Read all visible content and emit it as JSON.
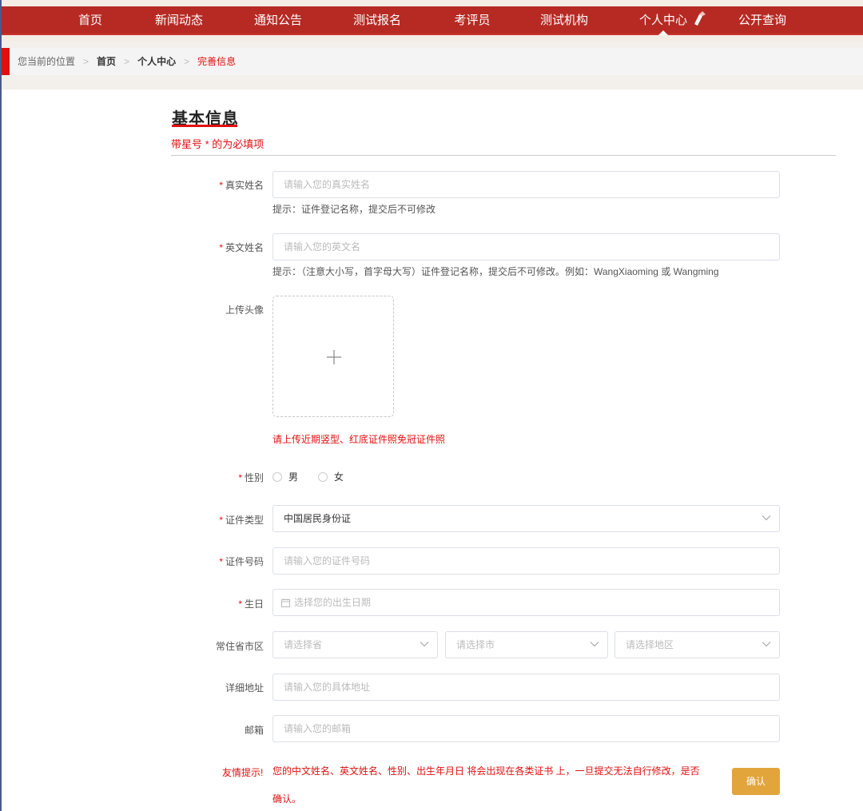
{
  "nav": {
    "items": [
      {
        "label": "首页"
      },
      {
        "label": "新闻动态"
      },
      {
        "label": "通知公告"
      },
      {
        "label": "测试报名"
      },
      {
        "label": "考评员"
      },
      {
        "label": "测试机构"
      },
      {
        "label": "个人中心"
      },
      {
        "label": "公开查询"
      }
    ],
    "active_index": 6
  },
  "breadcrumb": {
    "prefix": "您当前的位置",
    "items": [
      "首页",
      "个人中心",
      "完善信息"
    ]
  },
  "form": {
    "title": "基本信息",
    "required_note": "带星号 * 的为必填项",
    "real_name": {
      "label": "真实姓名",
      "placeholder": "请输入您的真实姓名",
      "hint": "提示：证件登记名称，提交后不可修改"
    },
    "english_name": {
      "label": "英文姓名",
      "placeholder": "请输入您的英文名",
      "hint": "提示：（注意大小写，首字母大写）证件登记名称，提交后不可修改。例如：WangXiaoming 或 Wangming"
    },
    "avatar": {
      "label": "上传头像",
      "note": "请上传近期竖型、红底证件照免冠证件照"
    },
    "gender": {
      "label": "性别",
      "options": [
        "男",
        "女"
      ]
    },
    "id_type": {
      "label": "证件类型",
      "value": "中国居民身份证"
    },
    "id_number": {
      "label": "证件号码",
      "placeholder": "请输入您的证件号码"
    },
    "birthday": {
      "label": "生日",
      "placeholder": "选择您的出生日期"
    },
    "region": {
      "label": "常住省市区",
      "province_placeholder": "请选择省",
      "city_placeholder": "请选择市",
      "district_placeholder": "请选择地区"
    },
    "address": {
      "label": "详细地址",
      "placeholder": "请输入您的具体地址"
    },
    "email": {
      "label": "邮箱",
      "placeholder": "请输入您的邮箱"
    },
    "warning_label": "友情提示!",
    "warning_text": "您的中文姓名、英文姓名、性别、出生年月日 将会出现在各类证书 上，一旦提交无法自行修改，是否确认。",
    "confirm_label": "确认"
  },
  "colors": {
    "nav_bg": "#b72a24",
    "accent_red": "#e01010",
    "confirm_bg": "#e2a53c"
  }
}
